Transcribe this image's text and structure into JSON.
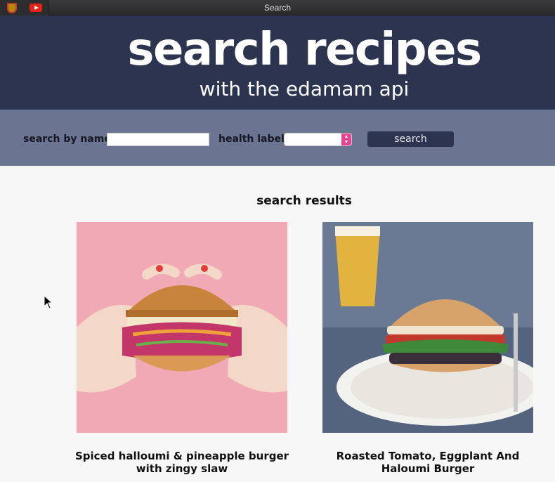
{
  "window": {
    "title": "Search"
  },
  "hero": {
    "title": "search recipes",
    "subtitle": "with the edamam api"
  },
  "search": {
    "name_label": "search by name",
    "name_value": "",
    "health_label": "health label",
    "health_value": "",
    "button_label": "search"
  },
  "results": {
    "heading": "search results",
    "items": [
      {
        "title": "Spiced halloumi & pineapple burger with zingy slaw"
      },
      {
        "title": "Roasted Tomato, Eggplant And Haloumi Burger"
      }
    ]
  },
  "colors": {
    "hero_bg": "#2d3450",
    "search_bg": "#6b7592",
    "page_bg": "#f7f7f7",
    "select_accent": "#e8438f"
  },
  "icons": [
    "shield-favicon-icon",
    "youtube-favicon-icon",
    "mouse-cursor-icon",
    "select-arrows-icon"
  ]
}
